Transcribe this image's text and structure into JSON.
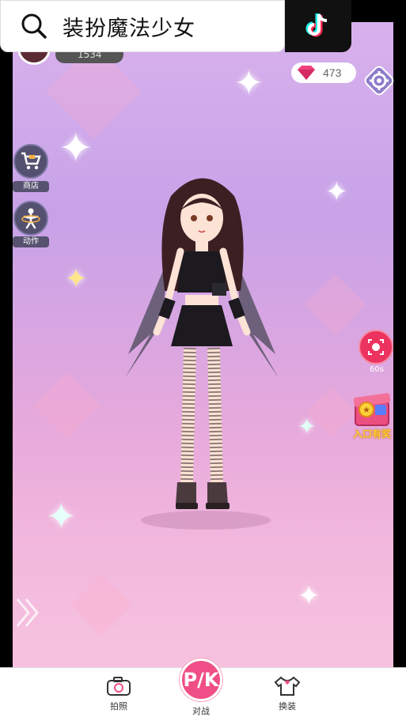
{
  "search": {
    "query": "装扮魔法少女"
  },
  "header": {
    "score": "1534",
    "gems": "473"
  },
  "sidebar": {
    "shop_label": "商店",
    "action_label": "动作"
  },
  "right_panel": {
    "record_timer": "60s",
    "reward_label": "入口有奖"
  },
  "bottom_nav": {
    "photo_label": "拍照",
    "battle_label": "对战",
    "battle_logo": "P/K",
    "outfit_label": "换装"
  },
  "colors": {
    "accent_pink": "#ef4f86",
    "record_red": "#ec335f",
    "side_button": "#545070"
  }
}
